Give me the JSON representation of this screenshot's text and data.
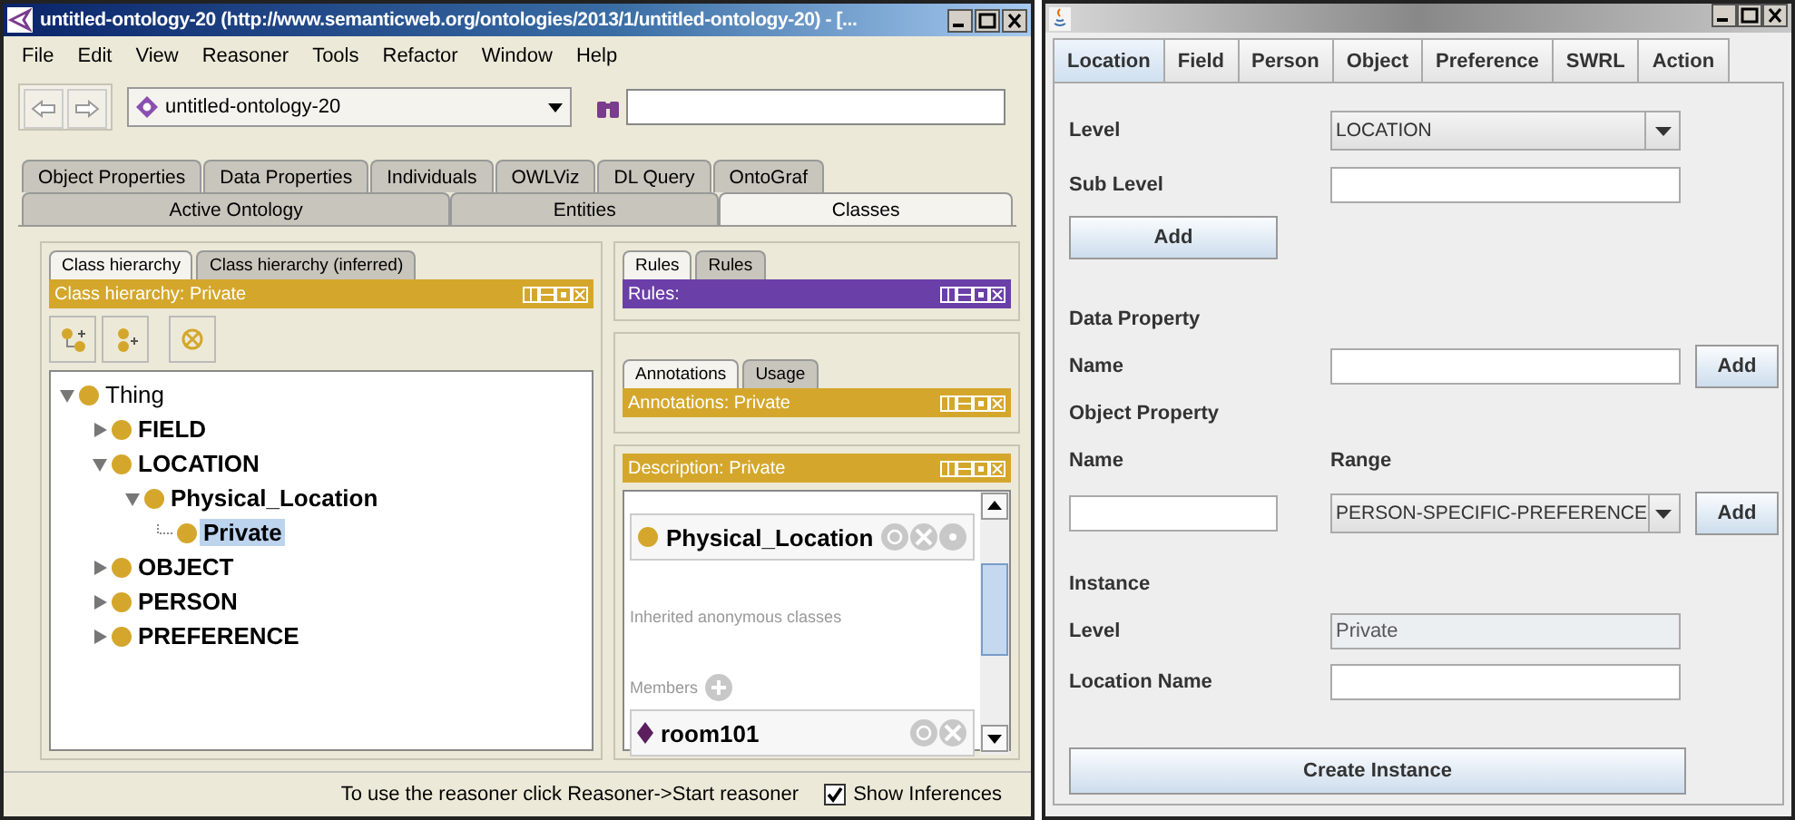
{
  "protege": {
    "title": "untitled-ontology-20 (http://www.semanticweb.org/ontologies/2013/1/untitled-ontology-20) - [...",
    "menu": [
      "File",
      "Edit",
      "View",
      "Reasoner",
      "Tools",
      "Refactor",
      "Window",
      "Help"
    ],
    "ontology_selector": {
      "value": "untitled-ontology-20"
    },
    "tab_row_1": [
      {
        "label": "Object Properties",
        "selected": false
      },
      {
        "label": "Data Properties",
        "selected": false
      },
      {
        "label": "Individuals",
        "selected": false
      },
      {
        "label": "OWLViz",
        "selected": false
      },
      {
        "label": "DL Query",
        "selected": false
      },
      {
        "label": "OntoGraf",
        "selected": false
      }
    ],
    "tab_row_2": [
      {
        "label": "Active Ontology",
        "selected": false
      },
      {
        "label": "Entities",
        "selected": false
      },
      {
        "label": "Classes",
        "selected": true
      }
    ],
    "class_panel": {
      "tabs": [
        {
          "label": "Class hierarchy",
          "selected": true
        },
        {
          "label": "Class hierarchy (inferred)",
          "selected": false
        }
      ],
      "header": "Class hierarchy: Private",
      "tree": [
        {
          "label": "Thing",
          "kind": "branch",
          "expanded": true,
          "selected": false,
          "children": [
            {
              "label": "FIELD",
              "kind": "branch",
              "expanded": false,
              "selected": false
            },
            {
              "label": "LOCATION",
              "kind": "branch",
              "expanded": true,
              "selected": false,
              "children": [
                {
                  "label": "Physical_Location",
                  "kind": "branch",
                  "expanded": true,
                  "selected": false,
                  "children": [
                    {
                      "label": "Private",
                      "kind": "leaf",
                      "selected": true
                    }
                  ]
                }
              ]
            },
            {
              "label": "OBJECT",
              "kind": "branch",
              "expanded": false,
              "selected": false
            },
            {
              "label": "PERSON",
              "kind": "branch",
              "expanded": false,
              "selected": false
            },
            {
              "label": "PREFERENCE",
              "kind": "branch",
              "expanded": false,
              "selected": false
            }
          ]
        }
      ]
    },
    "rules_panel": {
      "tabs": [
        {
          "label": "Rules",
          "selected": true
        },
        {
          "label": "Rules",
          "selected": false
        }
      ],
      "header": "Rules:"
    },
    "annotations_panel": {
      "tabs": [
        {
          "label": "Annotations",
          "selected": true
        },
        {
          "label": "Usage",
          "selected": false
        }
      ],
      "header": "Annotations: Private"
    },
    "description_panel": {
      "header": "Description: Private",
      "superclass": "Physical_Location",
      "inherited_label": "Inherited anonymous classes",
      "members_label": "Members",
      "members": [
        "room101"
      ]
    },
    "status": {
      "text": "To use the reasoner click Reasoner->Start reasoner",
      "show_inferences": {
        "label": "Show Inferences",
        "checked": true
      }
    }
  },
  "form": {
    "tabs": [
      {
        "label": "Location",
        "selected": true
      },
      {
        "label": "Field",
        "selected": false
      },
      {
        "label": "Person",
        "selected": false
      },
      {
        "label": "Object",
        "selected": false
      },
      {
        "label": "Preference",
        "selected": false
      },
      {
        "label": "SWRL",
        "selected": false
      },
      {
        "label": "Action",
        "selected": false
      }
    ],
    "level": {
      "label": "Level",
      "value": "LOCATION"
    },
    "sub_level": {
      "label": "Sub Level"
    },
    "add_button": "Add",
    "data_property": {
      "heading": "Data Property",
      "name_label": "Name",
      "add_button": "Add"
    },
    "object_property": {
      "heading": "Object Property",
      "name_label": "Name",
      "range_label": "Range",
      "range_value": "PERSON-SPECIFIC-PREFERENCE",
      "add_button": "Add"
    },
    "instance": {
      "heading": "Instance",
      "level_label": "Level",
      "level_value": "Private",
      "location_name_label": "Location Name"
    },
    "create_button": "Create Instance"
  }
}
